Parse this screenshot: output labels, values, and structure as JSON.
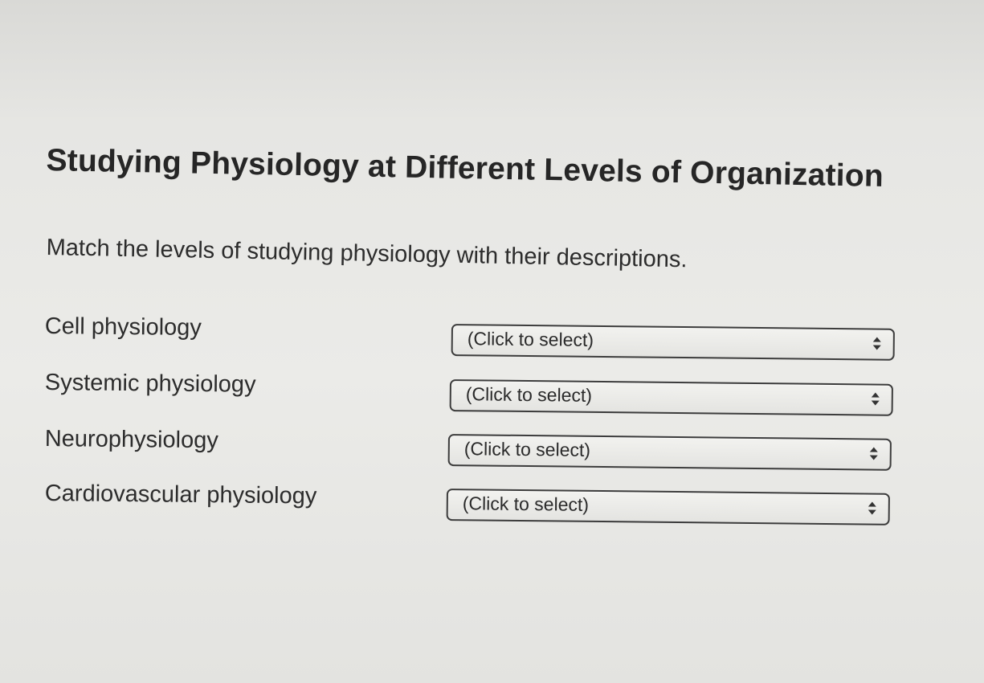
{
  "page": {
    "title": "Studying Physiology at Different Levels of Organization",
    "instructions": "Match the levels of studying physiology with their descriptions."
  },
  "matches": [
    {
      "term": "Cell physiology",
      "select_value": "(Click to select)"
    },
    {
      "term": "Systemic physiology",
      "select_value": "(Click to select)"
    },
    {
      "term": "Neurophysiology",
      "select_value": "(Click to select)"
    },
    {
      "term": "Cardiovascular physiology",
      "select_value": "(Click to select)"
    }
  ]
}
